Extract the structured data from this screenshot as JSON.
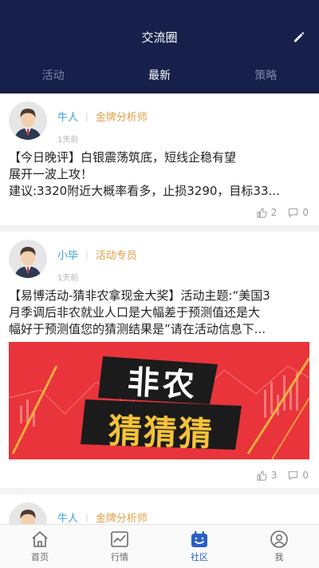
{
  "header": {
    "title": "交流圈",
    "edit_icon": "pencil-icon",
    "tabs": [
      {
        "label": "活动",
        "active": false
      },
      {
        "label": "最新",
        "active": true
      },
      {
        "label": "策略",
        "active": false
      }
    ]
  },
  "posts": [
    {
      "author": "牛人",
      "role": "金牌分析师",
      "time": "1天前",
      "lines": [
        "【今日晚评】白银震荡筑底，短线企稳有望",
        "展开一波上攻！",
        "建议:3320附近大概率看多，止损3290，目标33..."
      ],
      "likes": "2",
      "comments": "0"
    },
    {
      "author": "小毕",
      "role": "活动专员",
      "time": "1天前",
      "lines": [
        "【易博活动-猜非农拿现金大奖】活动主题:“美国3",
        "月季调后非农就业人口是大幅差于预测值还是大",
        "幅好于预测值您的猜测结果是”请在活动信息下..."
      ],
      "banner": {
        "line1": "非农",
        "line2": "猜猜猜"
      },
      "likes": "3",
      "comments": "0"
    },
    {
      "author": "牛人",
      "role": "金牌分析师"
    }
  ],
  "bottom_nav": [
    {
      "label": "首页",
      "icon": "home-icon",
      "active": false
    },
    {
      "label": "行情",
      "icon": "chart-icon",
      "active": false
    },
    {
      "label": "社区",
      "icon": "calendar-icon",
      "active": true
    },
    {
      "label": "我",
      "icon": "user-icon",
      "active": false
    }
  ],
  "colors": {
    "header_bg": "#16204a",
    "author": "#3aa0d8",
    "role": "#e0a048",
    "active_nav": "#2a5fc4",
    "banner_bg": "#e8343a"
  }
}
